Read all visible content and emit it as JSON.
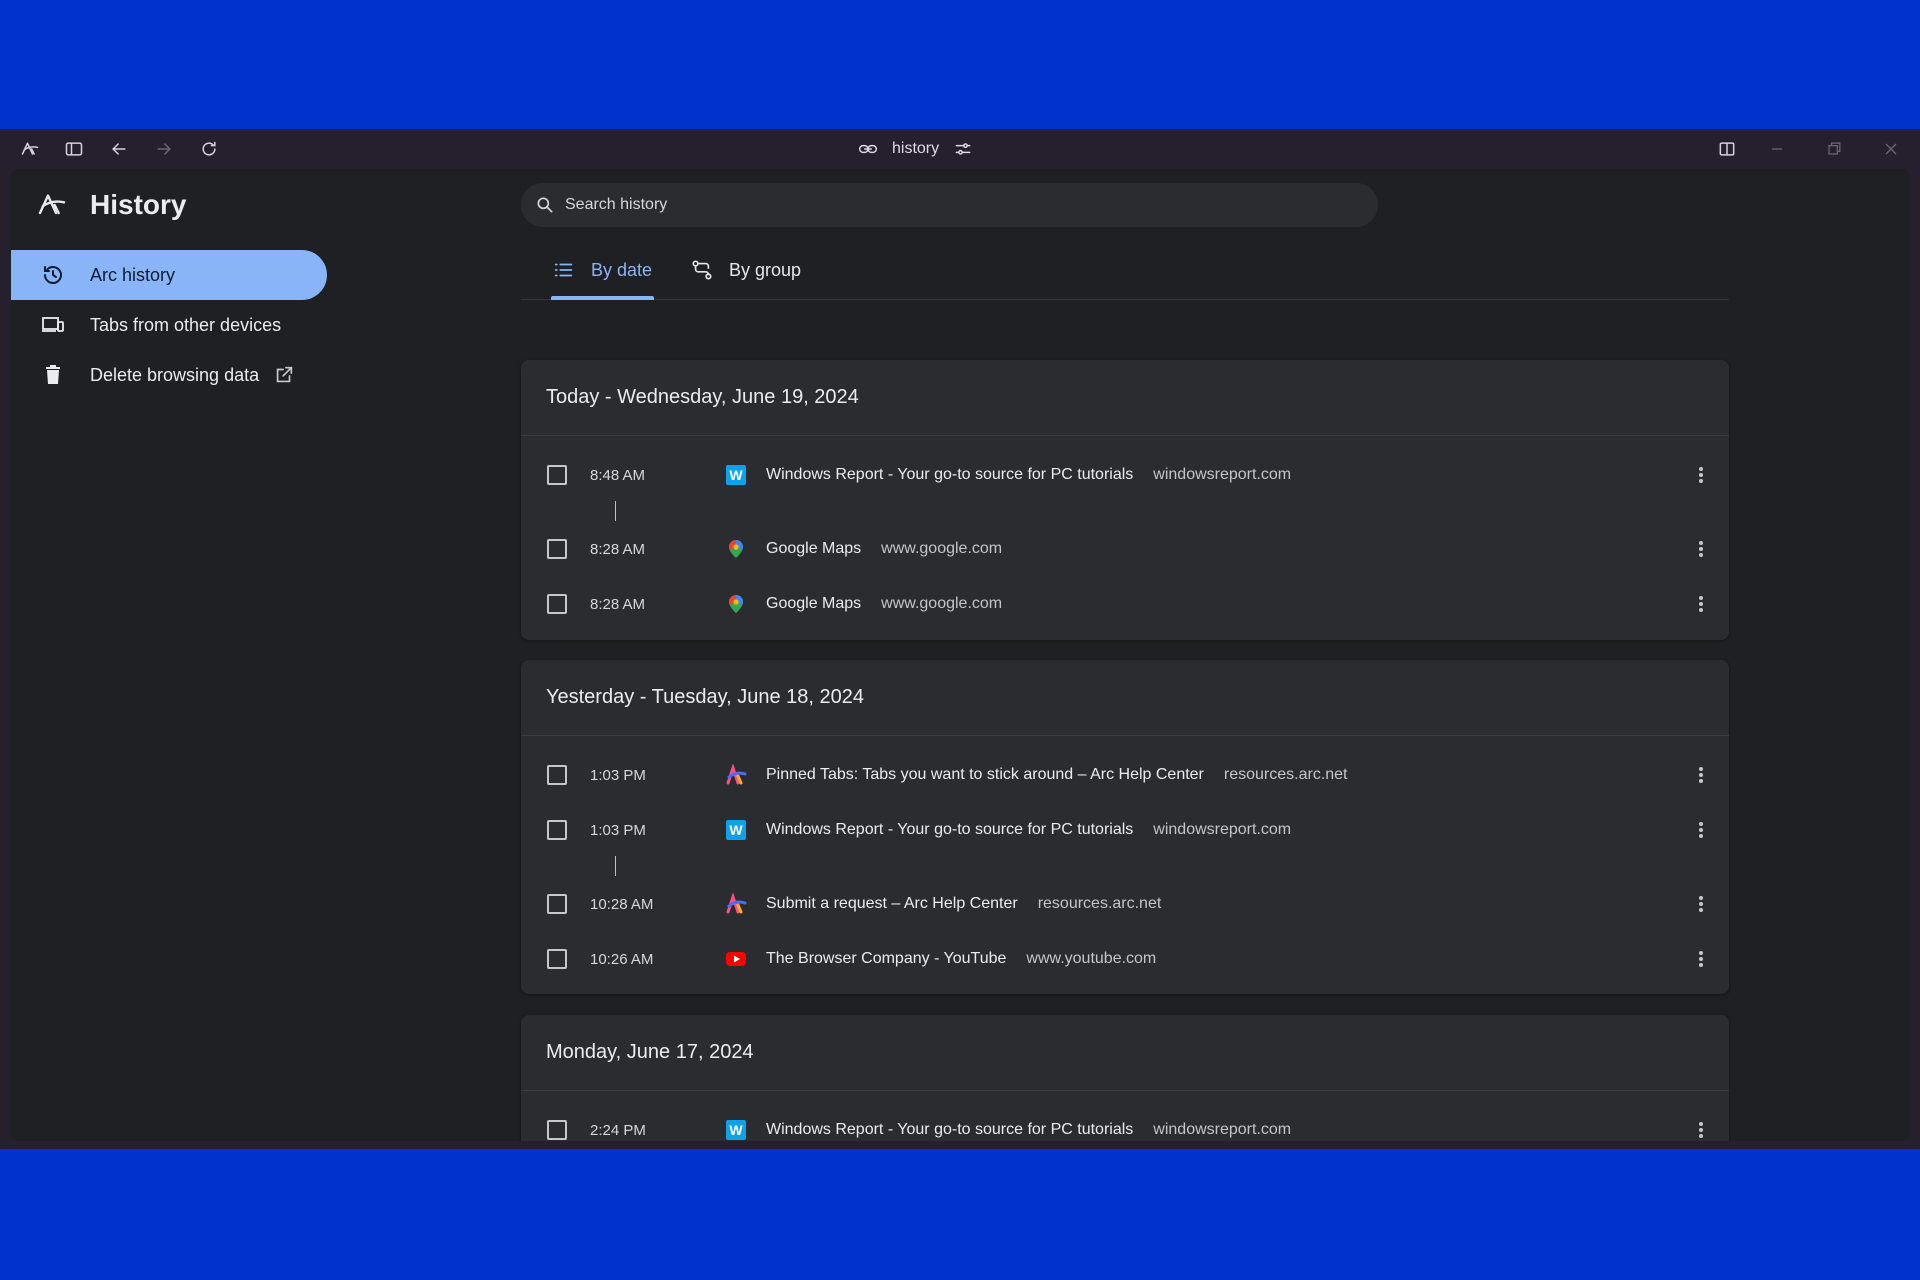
{
  "address_bar": {
    "text": "history"
  },
  "sidebar": {
    "title": "History",
    "items": [
      {
        "label": "Arc history",
        "icon": "history-clock-icon",
        "active": true
      },
      {
        "label": "Tabs from other devices",
        "icon": "devices-icon",
        "active": false
      },
      {
        "label": "Delete browsing data",
        "icon": "trash-icon",
        "active": false,
        "external": true
      }
    ]
  },
  "search": {
    "placeholder": "Search history",
    "value": ""
  },
  "tabs": [
    {
      "label": "By date",
      "icon": "list-icon",
      "active": true
    },
    {
      "label": "By group",
      "icon": "group-icon",
      "active": false
    }
  ],
  "groups": [
    {
      "header": "Today - Wednesday, June 19, 2024",
      "entries": [
        {
          "time": "8:48 AM",
          "favicon": "windowsreport-favicon",
          "title": "Windows Report - Your go-to source for PC tutorials",
          "domain": "windowsreport.com"
        },
        {
          "time": "8:28 AM",
          "favicon": "google-maps-favicon",
          "title": "Google Maps",
          "domain": "www.google.com"
        },
        {
          "time": "8:28 AM",
          "favicon": "google-maps-favicon",
          "title": "Google Maps",
          "domain": "www.google.com"
        }
      ]
    },
    {
      "header": "Yesterday - Tuesday, June 18, 2024",
      "entries": [
        {
          "time": "1:03 PM",
          "favicon": "arc-help-favicon",
          "title": "Pinned Tabs: Tabs you want to stick around – Arc Help Center",
          "domain": "resources.arc.net"
        },
        {
          "time": "1:03 PM",
          "favicon": "windowsreport-favicon",
          "title": "Windows Report - Your go-to source for PC tutorials",
          "domain": "windowsreport.com"
        },
        {
          "time": "10:28 AM",
          "favicon": "arc-help-favicon",
          "title": "Submit a request – Arc Help Center",
          "domain": "resources.arc.net"
        },
        {
          "time": "10:26 AM",
          "favicon": "youtube-favicon",
          "title": "The Browser Company - YouTube",
          "domain": "www.youtube.com"
        }
      ]
    },
    {
      "header": "Monday, June 17, 2024",
      "entries": [
        {
          "time": "2:24 PM",
          "favicon": "windowsreport-favicon",
          "title": "Windows Report - Your go-to source for PC tutorials",
          "domain": "windowsreport.com"
        }
      ]
    }
  ],
  "colors": {
    "accent": "#8ab4f8",
    "desktop": "#0132cc",
    "panel": "#1f2023",
    "card": "#2b2c30"
  }
}
